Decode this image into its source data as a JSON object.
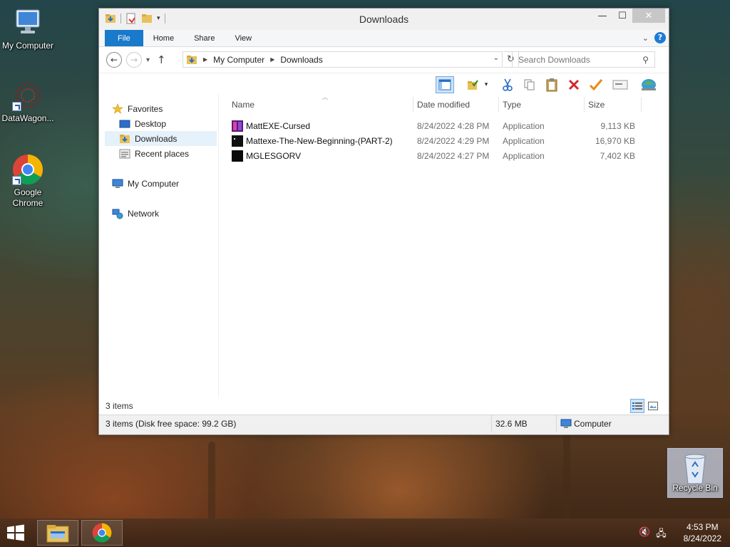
{
  "desktop": {
    "icons": [
      {
        "label": "My Computer",
        "icon": "computer-icon"
      },
      {
        "label": "DataWagon...",
        "icon": "datawagon-icon"
      },
      {
        "label": "Google Chrome",
        "icon": "chrome-icon"
      }
    ],
    "recycle_bin": {
      "label": "Recycle Bin",
      "icon": "recycle-bin-icon"
    }
  },
  "window": {
    "title": "Downloads",
    "controls": {
      "minimize": "—",
      "maximize": "☐",
      "close": "✕"
    }
  },
  "ribbon": {
    "tabs": [
      {
        "label": "File"
      },
      {
        "label": "Home"
      },
      {
        "label": "Share"
      },
      {
        "label": "View"
      }
    ],
    "help": "?"
  },
  "address": {
    "crumbs": [
      "My Computer",
      "Downloads"
    ],
    "search_placeholder": "Search Downloads"
  },
  "nav": {
    "favorites": "Favorites",
    "desktop": "Desktop",
    "downloads": "Downloads",
    "recent": "Recent places",
    "computer": "My Computer",
    "network": "Network"
  },
  "columns": {
    "name": "Name",
    "date": "Date modified",
    "type": "Type",
    "size": "Size"
  },
  "files": [
    {
      "name": "MattEXE-Cursed",
      "date": "8/24/2022 4:28 PM",
      "type": "Application",
      "size": "9,113 KB",
      "icon": "colorful-app-icon"
    },
    {
      "name": "Mattexe-The-New-Beginning-(PART-2)",
      "date": "8/24/2022 4:29 PM",
      "type": "Application",
      "size": "16,970 KB",
      "icon": "dark-app-icon"
    },
    {
      "name": "MGLESGORV",
      "date": "8/24/2022 4:27 PM",
      "type": "Application",
      "size": "7,402 KB",
      "icon": "black-app-icon"
    }
  ],
  "itembar": {
    "count": "3 items"
  },
  "status": {
    "items": "3 items (Disk free space: 99.2 GB)",
    "size": "32.6 MB",
    "location": "Computer"
  },
  "taskbar": {
    "apps": [
      "file-explorer-icon",
      "chrome-icon"
    ],
    "time": "4:53 PM",
    "date": "8/24/2022"
  }
}
